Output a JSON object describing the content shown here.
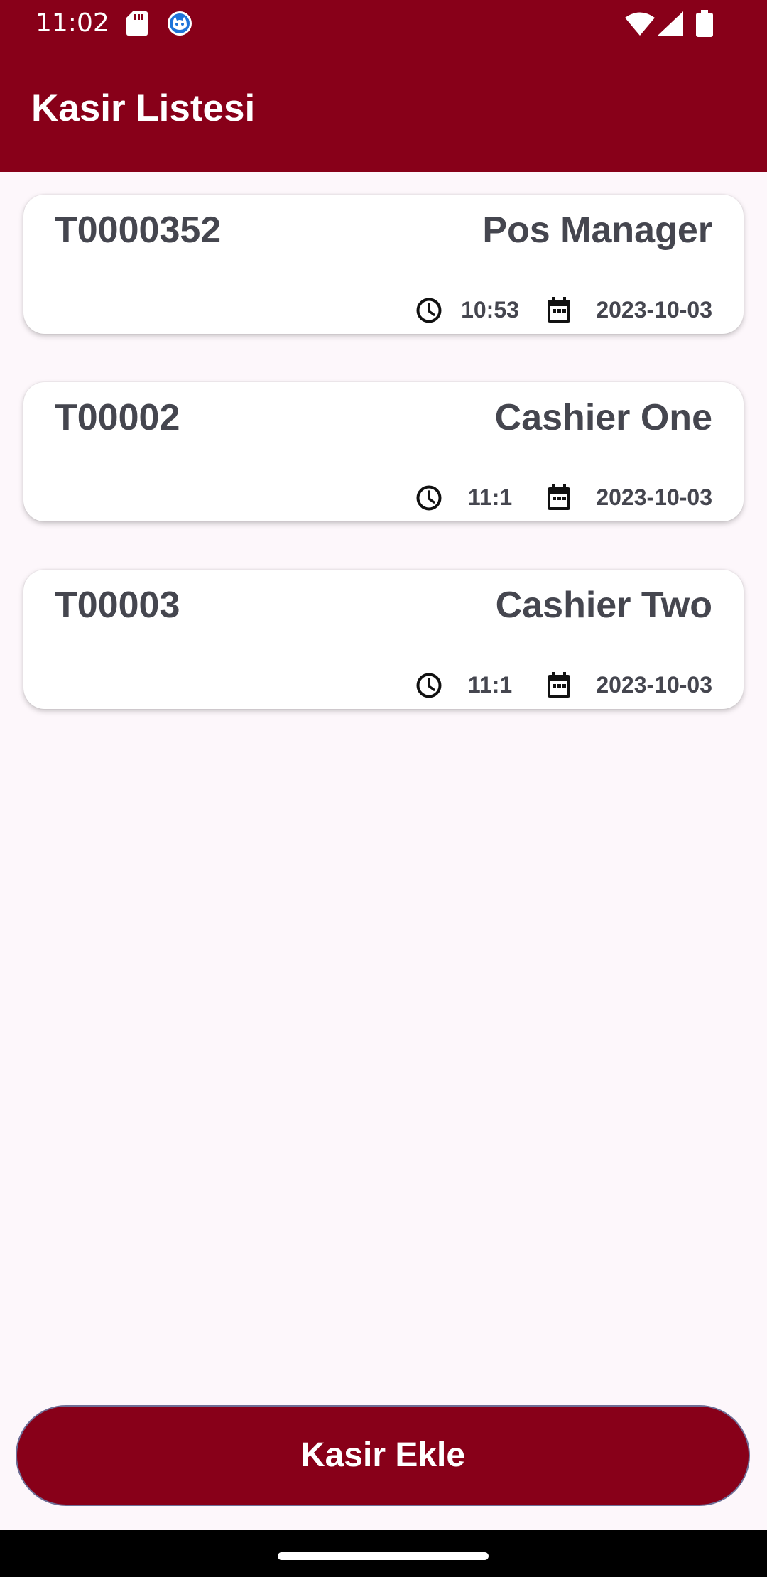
{
  "status_bar": {
    "time": "11:02",
    "icons": [
      "sd-card-icon",
      "cat-app-icon",
      "wifi-icon",
      "signal-icon",
      "battery-icon"
    ]
  },
  "app_bar": {
    "title": "Kasir Listesi"
  },
  "cashiers": [
    {
      "code": "T0000352",
      "name": "Pos Manager",
      "time": "10:53",
      "date": "2023-10-03"
    },
    {
      "code": "T00002",
      "name": "Cashier One",
      "time": "11:1",
      "date": "2023-10-03"
    },
    {
      "code": "T00003",
      "name": "Cashier Two",
      "time": "11:1",
      "date": "2023-10-03"
    }
  ],
  "add_button": {
    "label": "Kasir Ekle"
  },
  "colors": {
    "primary": "#880019",
    "background": "#FDF7FB",
    "card_text": "#45464F"
  }
}
